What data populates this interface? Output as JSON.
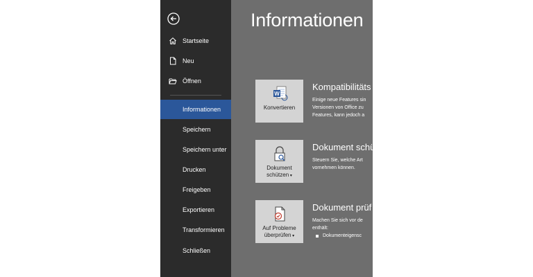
{
  "sidebar": {
    "back_icon": "back-arrow-icon",
    "items": [
      {
        "label": "Startseite",
        "icon": "home-icon"
      },
      {
        "label": "Neu",
        "icon": "new-document-icon"
      },
      {
        "label": "Öffnen",
        "icon": "open-folder-icon"
      },
      {
        "label": "Informationen"
      },
      {
        "label": "Speichern"
      },
      {
        "label": "Speichern unter"
      },
      {
        "label": "Drucken"
      },
      {
        "label": "Freigeben"
      },
      {
        "label": "Exportieren"
      },
      {
        "label": "Transformieren"
      },
      {
        "label": "Schließen"
      }
    ],
    "active_index": 3
  },
  "main": {
    "title": "Informationen",
    "sections": [
      {
        "button_label": "Konvertieren",
        "icon": "word-convert-icon",
        "title": "Kompatibilitäts",
        "lines": [
          "Einige neue Features sin",
          "Versionen von Office zu",
          "Features, kann jedoch a"
        ]
      },
      {
        "button_label_1": "Dokument",
        "button_label_2": "schützen",
        "icon": "lock-icon",
        "title": "Dokument schü",
        "lines": [
          "Steuern Sie, welche Art",
          "vornehmen können."
        ]
      },
      {
        "button_label_1": "Auf Probleme",
        "button_label_2": "überprüfen",
        "icon": "inspect-document-icon",
        "title": "Dokument prüf",
        "lines": [
          "Machen Sie sich vor de",
          "enthält:"
        ],
        "bullet": "Dokumenteigensc"
      }
    ]
  },
  "colors": {
    "sidebar_bg": "#2b2b2b",
    "active_bg": "#2b579a",
    "main_bg": "#6e6e6e",
    "tile_bg": "#d4d4d4"
  }
}
